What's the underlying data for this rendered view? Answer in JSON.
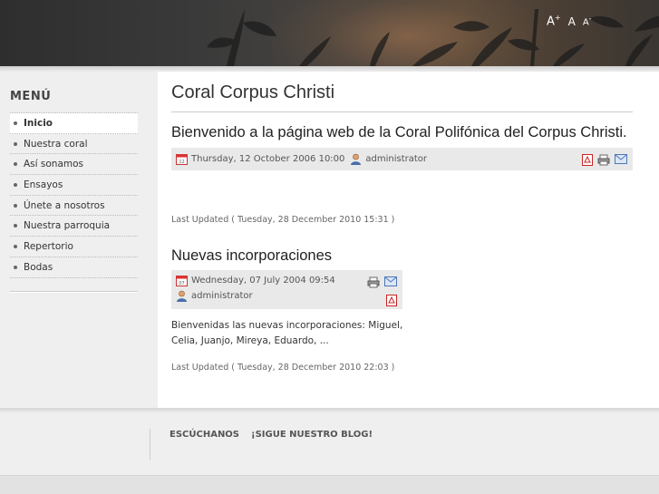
{
  "header": {
    "font_tools": {
      "increase": "A",
      "increase_sup": "+",
      "reset": "A",
      "decrease": "A",
      "decrease_sup": "-"
    }
  },
  "sidebar": {
    "title": "MENÚ",
    "items": [
      {
        "label": "Inicio",
        "active": true
      },
      {
        "label": "Nuestra coral"
      },
      {
        "label": "Así sonamos"
      },
      {
        "label": "Ensayos"
      },
      {
        "label": "Únete a nosotros"
      },
      {
        "label": "Nuestra parroquia"
      },
      {
        "label": "Repertorio"
      },
      {
        "label": "Bodas"
      }
    ]
  },
  "main": {
    "page_title": "Coral Corpus Christi",
    "articles": [
      {
        "title": "Bienvenido a la página web de la Coral Polifónica del Corpus Christi.",
        "date": "Thursday, 12 October 2006 10:00",
        "author": "administrator",
        "updated": "Last Updated ( Tuesday, 28 December 2010 15:31 )"
      },
      {
        "title": "Nuevas incorporaciones",
        "date": "Wednesday, 07 July 2004 09:54",
        "author": "administrator",
        "intro": "Bienvenidas las nuevas incorporaciones: Miguel, Celia, Juanjo, Mireya, Eduardo, ...",
        "updated": "Last Updated ( Tuesday, 28 December 2010 22:03 )"
      }
    ]
  },
  "footer": {
    "links": [
      "ESCÚCHANOS",
      "¡SIGUE NUESTRO BLOG!"
    ]
  },
  "colors": {
    "header_dark": "#2e2e2e",
    "pdf_red": "#cc2222",
    "email_blue": "#4a78b8"
  }
}
